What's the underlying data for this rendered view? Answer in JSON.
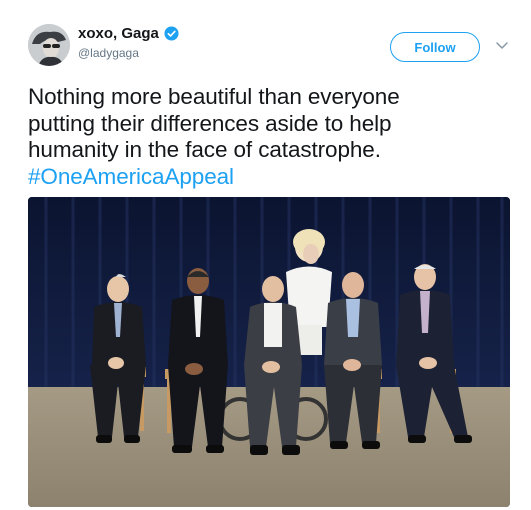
{
  "user": {
    "display_name": "xoxo, Gaga",
    "handle": "@ladygaga",
    "verified": true,
    "avatar_icon": "profile-photo"
  },
  "actions": {
    "follow_label": "Follow",
    "more_icon": "chevron-down-icon"
  },
  "tweet": {
    "text_lines": [
      "Nothing more beautiful than everyone",
      "putting their differences aside to help",
      "humanity in the face of catastrophe."
    ],
    "hashtag": "#OneAmericaAppeal"
  },
  "colors": {
    "accent": "#1da1f2",
    "text": "#14171a",
    "secondary_text": "#657786"
  }
}
